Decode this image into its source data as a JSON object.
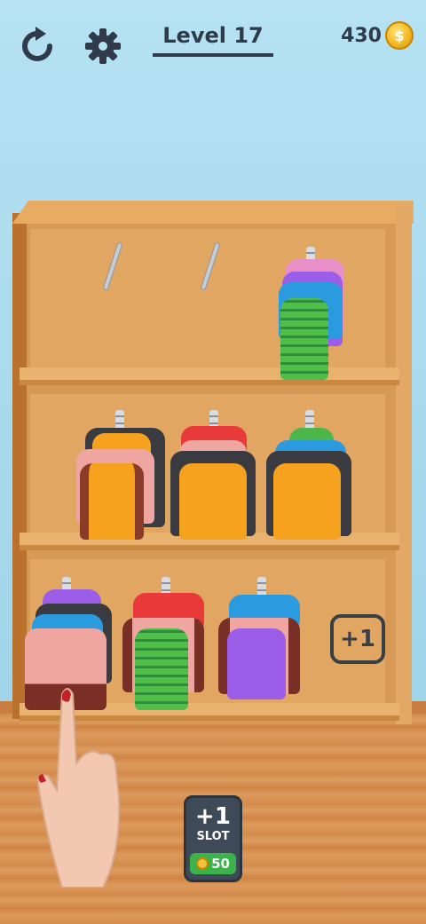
{
  "hud": {
    "level_label": "Level 17",
    "coins": "430",
    "coin_symbol": "$",
    "restart_icon": "restart-icon",
    "settings_icon": "gear-icon"
  },
  "shelf": {
    "rows": [
      {
        "slots": [
          {
            "state": "empty"
          },
          {
            "state": "empty"
          },
          {
            "state": "filled",
            "items": [
              "pink-jacket",
              "purple-sweater",
              "blue-shirt",
              "green-striped-sweater"
            ]
          }
        ]
      },
      {
        "slots": [
          {
            "state": "filled",
            "items": [
              "black-jacket",
              "orange-top",
              "pink-sweater",
              "orange-hoodie"
            ]
          },
          {
            "state": "filled",
            "items": [
              "red-shirt",
              "pink-jacket",
              "black-jacket",
              "orange-hoodie"
            ]
          },
          {
            "state": "filled",
            "items": [
              "green-shirt",
              "blue-shirt",
              "black-jacket",
              "orange-hoodie"
            ]
          }
        ]
      },
      {
        "slots": [
          {
            "state": "filled",
            "items": [
              "purple-sweater",
              "black-jacket",
              "blue-shirt",
              "pink-sweater"
            ]
          },
          {
            "state": "filled",
            "items": [
              "red-shirt",
              "pink-sweater",
              "green-striped-sweater"
            ]
          },
          {
            "state": "filled",
            "items": [
              "blue-shirt",
              "purple-top"
            ]
          },
          {
            "state": "locked",
            "label": "+1"
          }
        ]
      }
    ]
  },
  "slot_button": {
    "plus": "+1",
    "label": "SLOT",
    "cost": "50"
  },
  "colors": {
    "orange": "#f6a21f",
    "pink": "#efa6a0",
    "black": "#3a3b40",
    "green": "#4db64a",
    "blue": "#2b9be0",
    "purple": "#9c5ee8",
    "red": "#e83a3a"
  }
}
